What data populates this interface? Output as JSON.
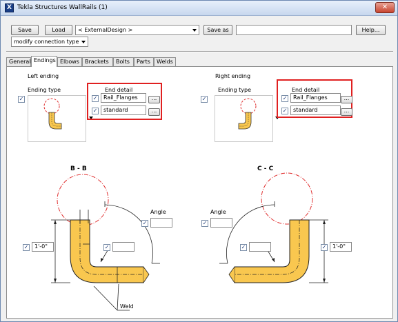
{
  "window": {
    "title": "Tekla Structures  WallRails (1)",
    "icon_glyph": "X",
    "close_glyph": "✕"
  },
  "toolbar": {
    "save_label": "Save",
    "load_label": "Load",
    "preset_value": "< ExternalDesign >",
    "save_as_label": "Save as",
    "save_as_name": "",
    "help_label": "Help...",
    "mode_value": "modify connection type"
  },
  "tabs": [
    {
      "label": "General"
    },
    {
      "label": "Endings"
    },
    {
      "label": "Elbows"
    },
    {
      "label": "Brackets"
    },
    {
      "label": "Bolts"
    },
    {
      "label": "Parts"
    },
    {
      "label": "Welds"
    }
  ],
  "active_tab": "Endings",
  "left": {
    "section_label": "Left ending",
    "ending_type_label": "Ending type",
    "end_detail_label": "End detail",
    "detail1_value": "Rail_Flanges",
    "detail2_value": "standard",
    "ellipsis": "..."
  },
  "right": {
    "section_label": "Right ending",
    "ending_type_label": "Ending type",
    "end_detail_label": "End detail",
    "detail1_value": "Rail_Flanges",
    "detail2_value": "standard",
    "ellipsis": "..."
  },
  "check_glyph": "✓",
  "diagram": {
    "left_section": "B - B",
    "right_section": "C - C",
    "angle_label_left": "Angle",
    "angle_label_right": "Angle",
    "left_height_value": "1'-0\"",
    "right_height_value": "1'-0\"",
    "weld_label": "Weld",
    "left_angle_value": "",
    "right_angle_value": "",
    "left_inner_value": "",
    "right_inner_value": ""
  },
  "colors": {
    "profile_fill": "#f9c74f",
    "highlight_red": "#e02020",
    "detail_circle": "#e03030"
  }
}
